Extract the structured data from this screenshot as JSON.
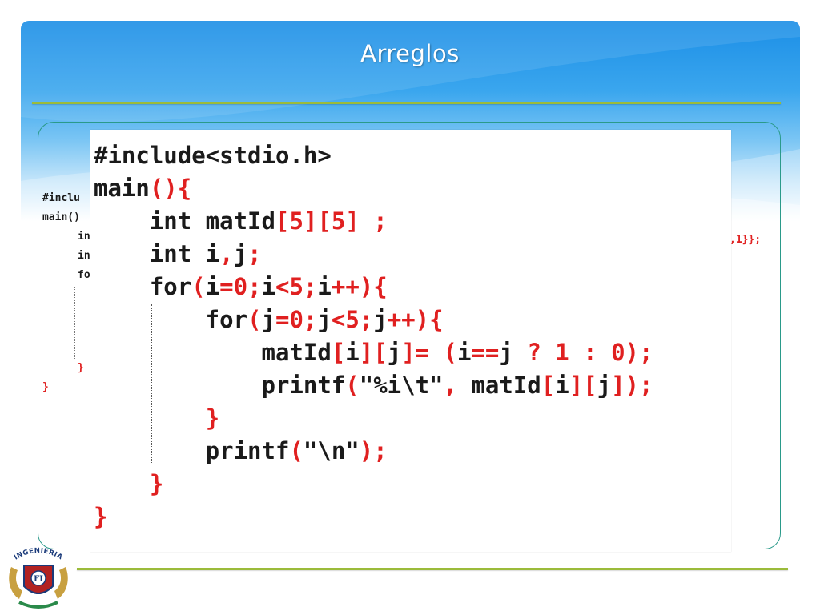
{
  "slide": {
    "title": "Arreglos"
  },
  "background_snippet": {
    "lines": [
      "#inclu",
      "main()",
      "in",
      "in",
      "fo",
      "}",
      "}"
    ],
    "tail": ",1}};"
  },
  "code": {
    "lines": [
      [
        {
          "t": "#include<stdio.h>"
        }
      ],
      [
        {
          "t": "main"
        },
        {
          "t": "(){",
          "c": "r"
        }
      ],
      [
        {
          "t": "    int matId"
        },
        {
          "t": "[5][5]",
          "c": "r"
        },
        {
          "t": " "
        },
        {
          "t": ";",
          "c": "r"
        }
      ],
      [
        {
          "t": "    int i"
        },
        {
          "t": ",",
          "c": "r"
        },
        {
          "t": "j"
        },
        {
          "t": ";",
          "c": "r"
        }
      ],
      [
        {
          "t": "    for"
        },
        {
          "t": "(",
          "c": "r"
        },
        {
          "t": "i"
        },
        {
          "t": "=0;",
          "c": "r"
        },
        {
          "t": "i"
        },
        {
          "t": "<5;",
          "c": "r"
        },
        {
          "t": "i"
        },
        {
          "t": "++){",
          "c": "r"
        }
      ],
      [
        {
          "t": "        for"
        },
        {
          "t": "(",
          "c": "r"
        },
        {
          "t": "j"
        },
        {
          "t": "=0;",
          "c": "r"
        },
        {
          "t": "j"
        },
        {
          "t": "<5;",
          "c": "r"
        },
        {
          "t": "j"
        },
        {
          "t": "++){",
          "c": "r"
        }
      ],
      [
        {
          "t": "            matId"
        },
        {
          "t": "[",
          "c": "r"
        },
        {
          "t": "i"
        },
        {
          "t": "][",
          "c": "r"
        },
        {
          "t": "j"
        },
        {
          "t": "]=",
          "c": "r"
        },
        {
          "t": " "
        },
        {
          "t": "(",
          "c": "r"
        },
        {
          "t": "i"
        },
        {
          "t": "==",
          "c": "r"
        },
        {
          "t": "j "
        },
        {
          "t": "? 1 : 0);",
          "c": "r"
        }
      ],
      [
        {
          "t": "            printf"
        },
        {
          "t": "(",
          "c": "r"
        },
        {
          "t": "\"%i\\t\""
        },
        {
          "t": ",",
          "c": "r"
        },
        {
          "t": " matId"
        },
        {
          "t": "[",
          "c": "r"
        },
        {
          "t": "i"
        },
        {
          "t": "][",
          "c": "r"
        },
        {
          "t": "j"
        },
        {
          "t": "]);",
          "c": "r"
        }
      ],
      [
        {
          "t": "        "
        },
        {
          "t": "}",
          "c": "r"
        }
      ],
      [
        {
          "t": "        printf"
        },
        {
          "t": "(",
          "c": "r"
        },
        {
          "t": "\"\\n\""
        },
        {
          "t": ");",
          "c": "r"
        }
      ],
      [
        {
          "t": "    "
        },
        {
          "t": "}",
          "c": "r"
        }
      ],
      [
        {
          "t": "}",
          "c": "r"
        }
      ]
    ]
  },
  "logo": {
    "text": "INGENIERIA",
    "letters": "FI"
  },
  "colors": {
    "header_blue": "#1b8ee6",
    "rule_green": "#9bbb3a",
    "frame_teal": "#2a9a8a",
    "code_red": "#e02020",
    "code_text": "#1a1a1a"
  }
}
